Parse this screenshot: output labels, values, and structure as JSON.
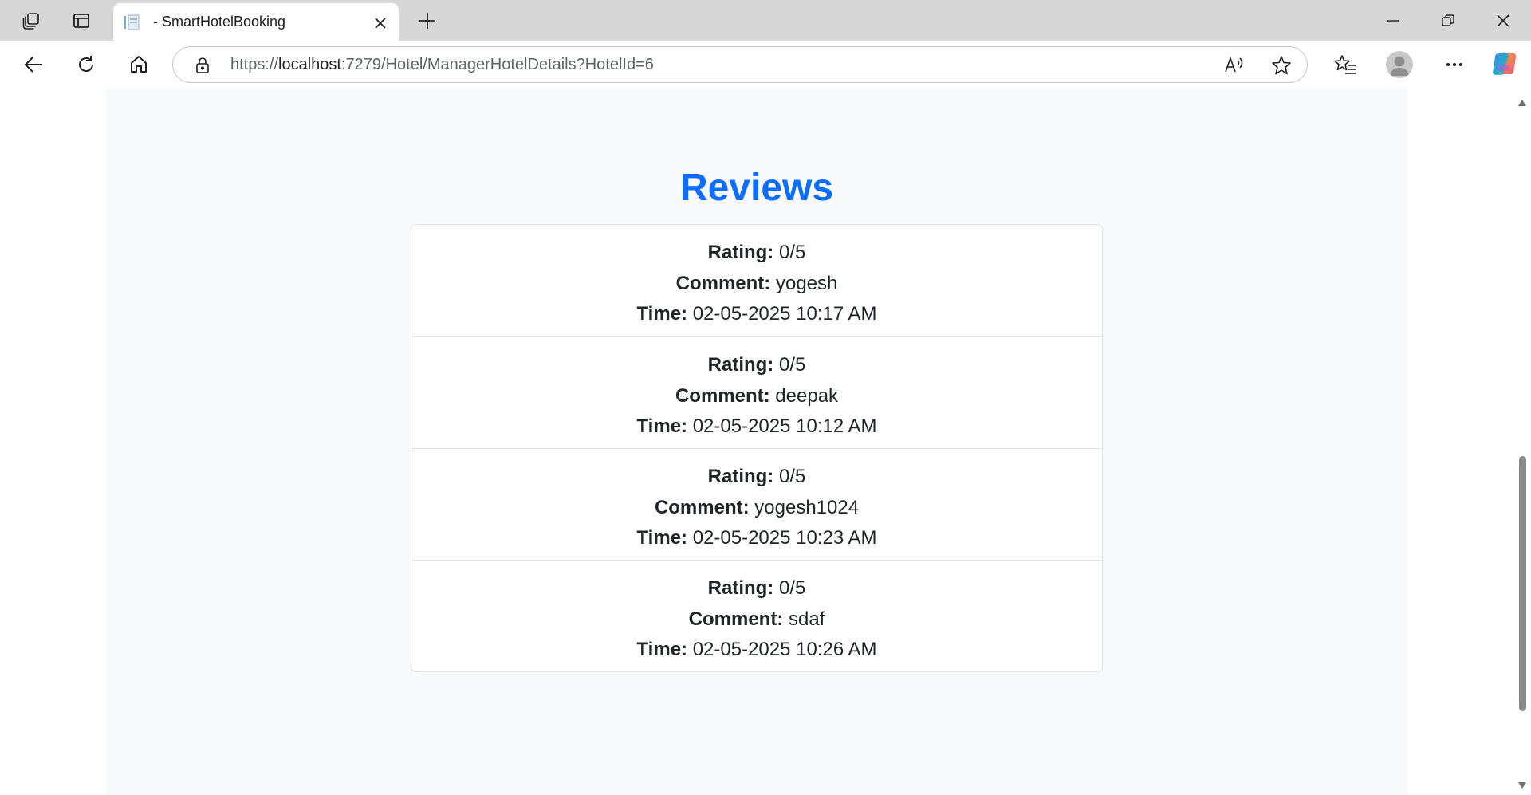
{
  "browser": {
    "tab_title": "- SmartHotelBooking",
    "url_prefix": "https://",
    "url_host": "localhost",
    "url_rest": ":7279/Hotel/ManagerHotelDetails?HotelId=6"
  },
  "page": {
    "heading": "Reviews",
    "labels": {
      "rating": "Rating:",
      "comment": "Comment:",
      "time": "Time:"
    },
    "reviews": [
      {
        "rating": "0/5",
        "comment": "yogesh",
        "time": "02-05-2025 10:17 AM"
      },
      {
        "rating": "0/5",
        "comment": "deepak",
        "time": "02-05-2025 10:12 AM"
      },
      {
        "rating": "0/5",
        "comment": "yogesh1024",
        "time": "02-05-2025 10:23 AM"
      },
      {
        "rating": "0/5",
        "comment": "sdaf",
        "time": "02-05-2025 10:26 AM"
      }
    ]
  },
  "colors": {
    "heading": "#0d6efd",
    "page_background": "#f8f9fa",
    "card_border": "#dee2e6"
  }
}
